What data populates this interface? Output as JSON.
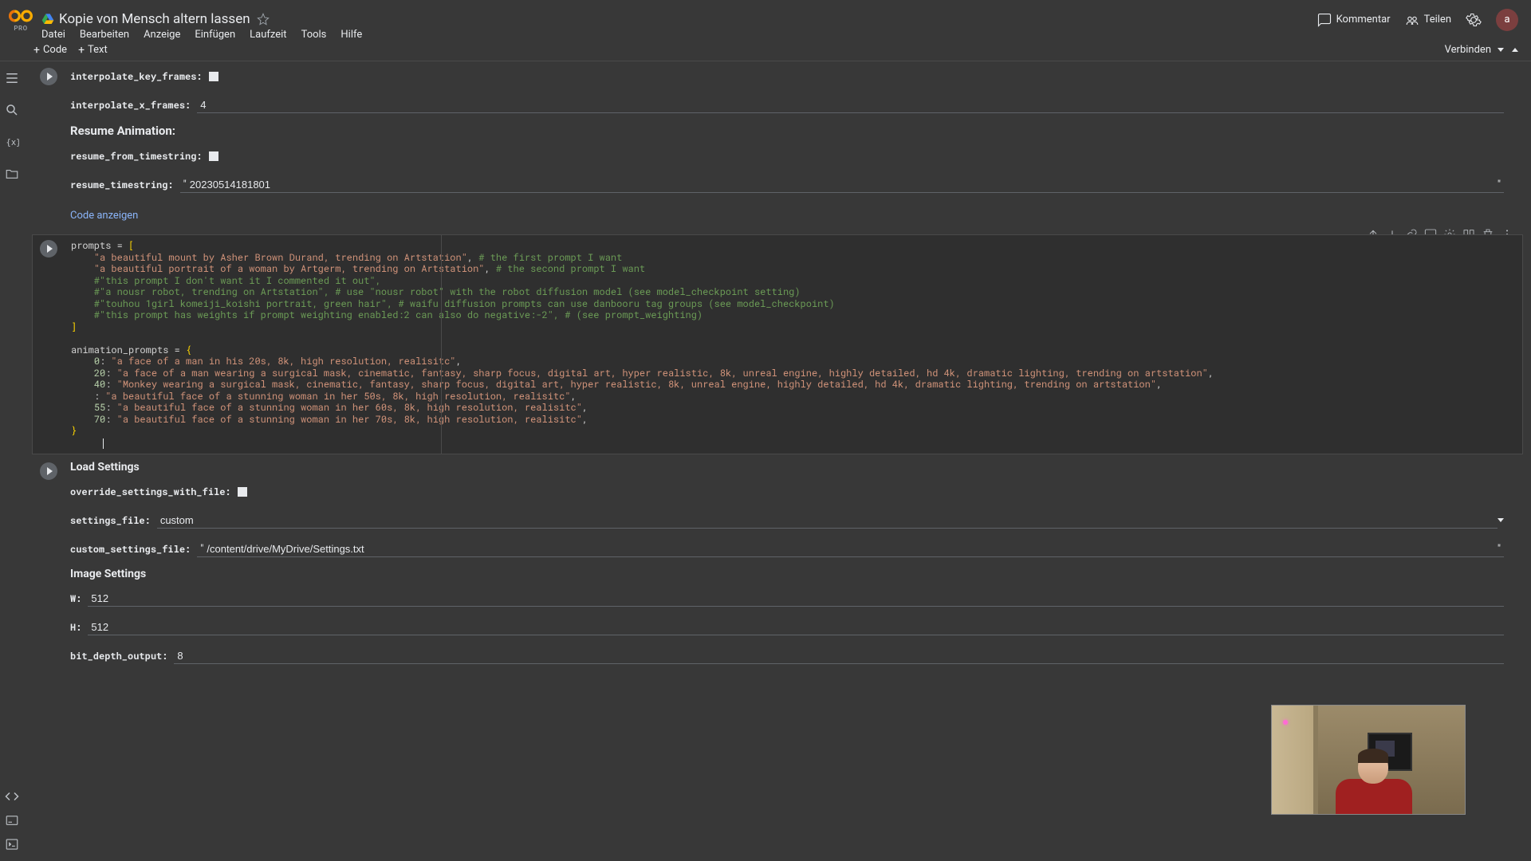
{
  "header": {
    "pro": "PRO",
    "title": "Kopie von Mensch altern lassen",
    "comment": "Kommentar",
    "share": "Teilen",
    "avatar": "a"
  },
  "menu": {
    "file": "Datei",
    "edit": "Bearbeiten",
    "view": "Anzeige",
    "insert": "Einfügen",
    "runtime": "Laufzeit",
    "tools": "Tools",
    "help": "Hilfe"
  },
  "toolbar": {
    "code": "Code",
    "text": "Text",
    "connect": "Verbinden"
  },
  "form1": {
    "interpolate_key_frames": "interpolate_key_frames:",
    "interpolate_x_frames": "interpolate_x_frames:",
    "interpolate_x_frames_val": "4",
    "resume_heading": "Resume Animation:",
    "resume_from_timestring": "resume_from_timestring:",
    "resume_timestring": "resume_timestring:",
    "resume_timestring_val": "20230514181801",
    "show_code": "Code anzeigen"
  },
  "code": {
    "l1a": "prompts = ",
    "l1b": "[",
    "l2a": "    ",
    "l2s": "\"a beautiful mount by Asher Brown Durand, trending on Artstation\"",
    "l2p": ", ",
    "l2c": "# the first prompt I want",
    "l3s": "\"a beautiful portrait of a woman by Artgerm, trending on Artstation\"",
    "l3c": "# the second prompt I want",
    "l4": "    #\"this prompt I don't want it I commented it out\",",
    "l5": "    #\"a nousr robot, trending on Artstation\", # use \"nousr robot\" with the robot diffusion model (see model_checkpoint setting)",
    "l6": "    #\"touhou 1girl komeiji_koishi portrait, green hair\", # waifu diffusion prompts can use danbooru tag groups (see model_checkpoint)",
    "l7": "    #\"this prompt has weights if prompt weighting enabled:2 can also do negative:-2\", # (see prompt_weighting)",
    "l8": "]",
    "l10a": "animation_prompts = ",
    "l10b": "{",
    "l11k": "0",
    "l11s": "\"a face of a man in his 20s, 8k, high resolution, realisitc\"",
    "l12k": "20",
    "l12s": "\"a face of a man wearing a surgical mask, cinematic, fantasy, sharp focus, digital art, hyper realistic, 8k, unreal engine, highly detailed, hd 4k, dramatic lighting, trending on artstation\"",
    "l13k": "40",
    "l13s": "\"Monkey wearing a surgical mask, cinematic, fantasy, sharp focus, digital art, hyper realistic, 8k, unreal engine, highly detailed, hd 4k, dramatic lighting, trending on artstation\"",
    "l14s": "\"a beautiful face of a stunning woman in her 50s, 8k, high resolution, realisitc\"",
    "l15k": "55",
    "l15s": "\"a beautiful face of a stunning woman in her 60s, 8k, high resolution, realisitc\"",
    "l16k": "70",
    "l16s": "\"a beautiful face of a stunning woman in her 70s, 8k, high resolution, realisitc\"",
    "l17": "}"
  },
  "form2": {
    "load_heading": "Load Settings",
    "override": "override_settings_with_file:",
    "settings_file": "settings_file:",
    "settings_file_val": "custom",
    "custom_settings_file": "custom_settings_file:",
    "custom_settings_file_val": "/content/drive/MyDrive/Settings.txt",
    "image_heading": "Image Settings",
    "w": "W:",
    "w_val": "512",
    "h": "H:",
    "h_val": "512",
    "bit_depth": "bit_depth_output:",
    "bit_depth_val": "8"
  }
}
